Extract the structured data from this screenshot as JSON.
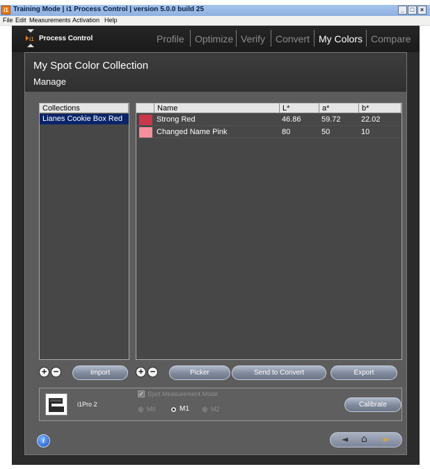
{
  "titlebar": {
    "icon_text": "i1",
    "title": "Training Mode | i1 Process Control | version 5.0.0 build 25",
    "minimize": "_",
    "maximize": "□",
    "close": "×"
  },
  "menu": [
    "File",
    "Edit",
    "Measurements",
    "Activation",
    "Help"
  ],
  "brand": "Process Control",
  "nav": {
    "items": [
      "Profile",
      "Optimize",
      "Verify",
      "Convert",
      "My Colors",
      "Compare"
    ],
    "active": "My Colors"
  },
  "panel": {
    "title": "My Spot Color Collection",
    "subtitle": "Manage"
  },
  "collections": {
    "header": "Collections",
    "items": [
      {
        "name": "Lianes Cookie Box Red",
        "selected": true
      }
    ]
  },
  "colors_table": {
    "headers": {
      "swatch": "",
      "name": "Name",
      "L": "L*",
      "a": "a*",
      "b": "b*"
    },
    "rows": [
      {
        "swatch": "#c8384a",
        "name": "Strong Red",
        "L": "46.86",
        "a": "59.72",
        "b": "22.02"
      },
      {
        "swatch": "#f3909c",
        "name": "Changed Name Pink",
        "L": "80",
        "a": "50",
        "b": "10"
      }
    ]
  },
  "buttons": {
    "add": "+",
    "remove": "−",
    "import": "Import",
    "picker": "Picker",
    "send_to_convert": "Send to Convert",
    "export": "Export",
    "calibrate": "Calibrate"
  },
  "device": {
    "name": "i1Pro 2",
    "spot_mode_label": "Spot Measurement Mode",
    "spot_mode_checked": true,
    "modes": [
      "M0",
      "M1",
      "M2"
    ],
    "selected_mode": "M1"
  },
  "footer": {
    "info": "i",
    "back": "◄",
    "home": "⌂",
    "forward": "►"
  },
  "colors": {
    "accent_selection": "#0a246a",
    "active_nav": "#ffffff",
    "inactive_nav": "#8b8b8b",
    "brand_orange": "#e87a1e"
  }
}
